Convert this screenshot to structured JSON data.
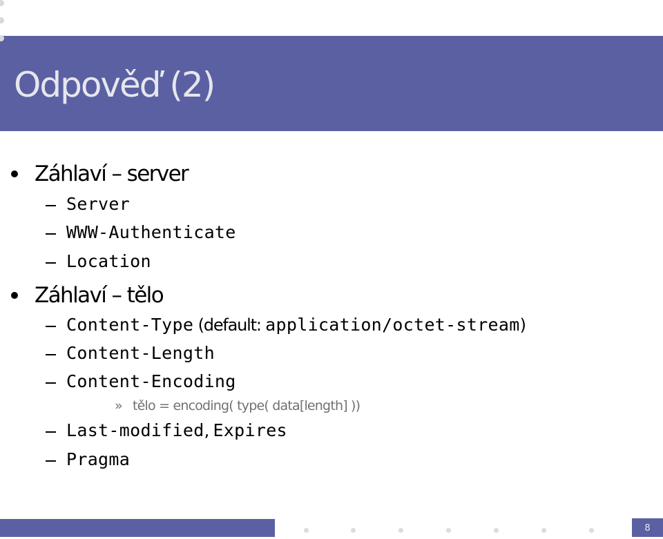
{
  "slide": {
    "title": "Odpověď (2)",
    "page_number": "8",
    "accent_color": "#5b60a2",
    "sections": [
      {
        "heading": "Záhlaví – server",
        "items": [
          {
            "code": "Server"
          },
          {
            "code": "WWW-Authenticate"
          },
          {
            "code": "Location"
          }
        ]
      },
      {
        "heading": "Záhlaví – tělo",
        "items": [
          {
            "code": "Content-Type",
            "text": " (default: ",
            "code2": "application/octet-stream",
            "text2": ")"
          },
          {
            "code": "Content-Length"
          },
          {
            "code": "Content-Encoding",
            "subitem": "tělo = encoding( type( data[length] ))"
          },
          {
            "code": "Last-modified",
            "text": ", ",
            "code2": "Expires"
          },
          {
            "code": "Pragma"
          }
        ]
      }
    ],
    "subbullet_glyph": "»"
  }
}
